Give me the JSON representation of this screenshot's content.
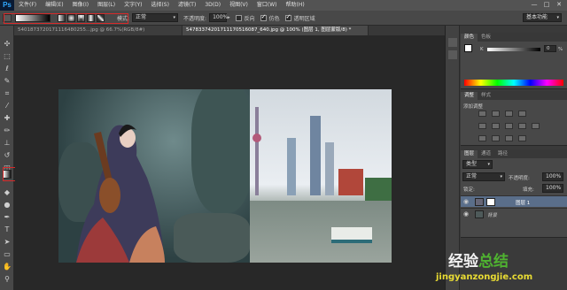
{
  "app": {
    "logo": "Ps"
  },
  "menu": [
    "文件(F)",
    "编辑(E)",
    "图像(I)",
    "图层(L)",
    "文字(Y)",
    "选择(S)",
    "滤镜(T)",
    "3D(D)",
    "视图(V)",
    "窗口(W)",
    "帮助(H)"
  ],
  "window_controls": [
    "—",
    "□",
    "✕"
  ],
  "options": {
    "mode_label": "模式:",
    "mode_value": "正常",
    "opacity_label": "不透明度:",
    "opacity_value": "100%",
    "reverse_label": "反向",
    "dither_label": "仿色",
    "transparency_label": "透明区域",
    "reverse_checked": false,
    "dither_checked": true,
    "transparency_checked": true,
    "workspace": "基本功能"
  },
  "tabs": [
    {
      "label": "5401873720171116480255...jpg @ 66.7%(RGB/8#)",
      "active": false
    },
    {
      "label": "54783374201711170516087_640.jpg @ 100% (图层 1, 图层蒙版/8) *",
      "active": true
    }
  ],
  "panels": {
    "color": {
      "tabs": [
        "颜色",
        "色板"
      ],
      "k_label": "K",
      "k_value": "0",
      "k_unit": "%"
    },
    "adjust": {
      "tabs": [
        "调整",
        "样式"
      ],
      "add_label": "添加调整"
    },
    "layers": {
      "tabs": [
        "图层",
        "通道",
        "路径"
      ],
      "filter": "类型",
      "blend": "正常",
      "opacity_label": "不透明度:",
      "opacity_value": "100%",
      "lock_label": "锁定:",
      "fill_label": "填充:",
      "fill_value": "100%",
      "rows": [
        {
          "name": "图层 1"
        },
        {
          "name": "背景"
        }
      ]
    }
  },
  "watermark": {
    "line1a": "经验",
    "line1b": "总结",
    "line2": "jingyanzongjie.com"
  },
  "colors": {
    "highlight": "#d62a2a",
    "accent": "#4fb330",
    "wm_yellow": "#e9dc33"
  }
}
